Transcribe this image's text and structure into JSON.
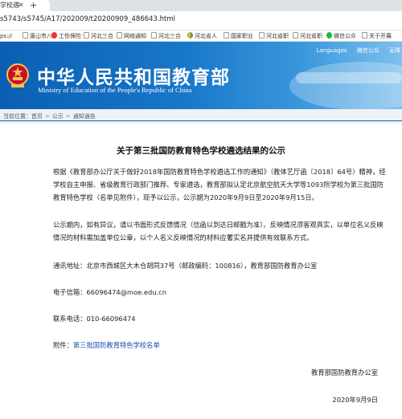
{
  "browser": {
    "tab_title": "学校遴",
    "url": "s5743/s5745/A17/202009/t20200909_486643.html",
    "bookmarks": [
      {
        "label": "ps://",
        "icon": "none"
      },
      {
        "label": "唐山市八",
        "icon": "page-icon"
      },
      {
        "label": "工伤保险",
        "icon": "red-circle-icon"
      },
      {
        "label": "河北三合",
        "icon": "page-icon"
      },
      {
        "label": "网络通知",
        "icon": "page-icon"
      },
      {
        "label": "河北三合",
        "icon": "page-icon"
      },
      {
        "label": "河北省人",
        "icon": "colorful-icon"
      },
      {
        "label": "国家职业",
        "icon": "page-icon"
      },
      {
        "label": "河北省职",
        "icon": "page-icon"
      },
      {
        "label": "河北省职",
        "icon": "page-icon"
      },
      {
        "label": "微信公众",
        "icon": "wechat-icon"
      },
      {
        "label": "关于开展",
        "icon": "page-icon"
      }
    ]
  },
  "site": {
    "title": "中华人民共和国教育部",
    "subtitle": "Ministry of Education of the People's Republic of China",
    "top_links": [
      "Languages",
      "微信公众",
      "无障"
    ]
  },
  "breadcrumb": [
    "当前位置：首页",
    "公示",
    "通知通告"
  ],
  "article": {
    "title": "关于第三批国防教育特色学校遴选结果的公示",
    "p1": "根据《教育部办公厅关于做好2018年国防教育特色学校遴选工作的通知》（教体艺厅函〔2018〕64号）精神，经学校自主申报、省级教育行政部门推荐、专家遴选，教育部拟认定北京航空航天大学等1093所学校为第三批国防教育特色学校（名单见附件），现予以公示，公示期为2020年9月9日至2020年9月15日。",
    "p2": "公示期内，如有异议，请以书面形式反馈情况（信函以到达日邮戳为准）。反映情况须客观真实，以单位名义反映情况的材料需加盖单位公章，以个人名义反映情况的材料应署实名并提供有效联系方式。",
    "address": "通讯地址：北京市西城区大木仓胡同37号（邮政编码：100816），教育部国防教育办公室",
    "email": "电子信箱：66096474@moe.edu.cn",
    "phone": "联系电话：010-66096474",
    "attachment_label": "附件：",
    "attachment_link": "第三批国防教育特色学校名单",
    "signature": "教育部国防教育办公室",
    "date": "2020年9月9日"
  }
}
